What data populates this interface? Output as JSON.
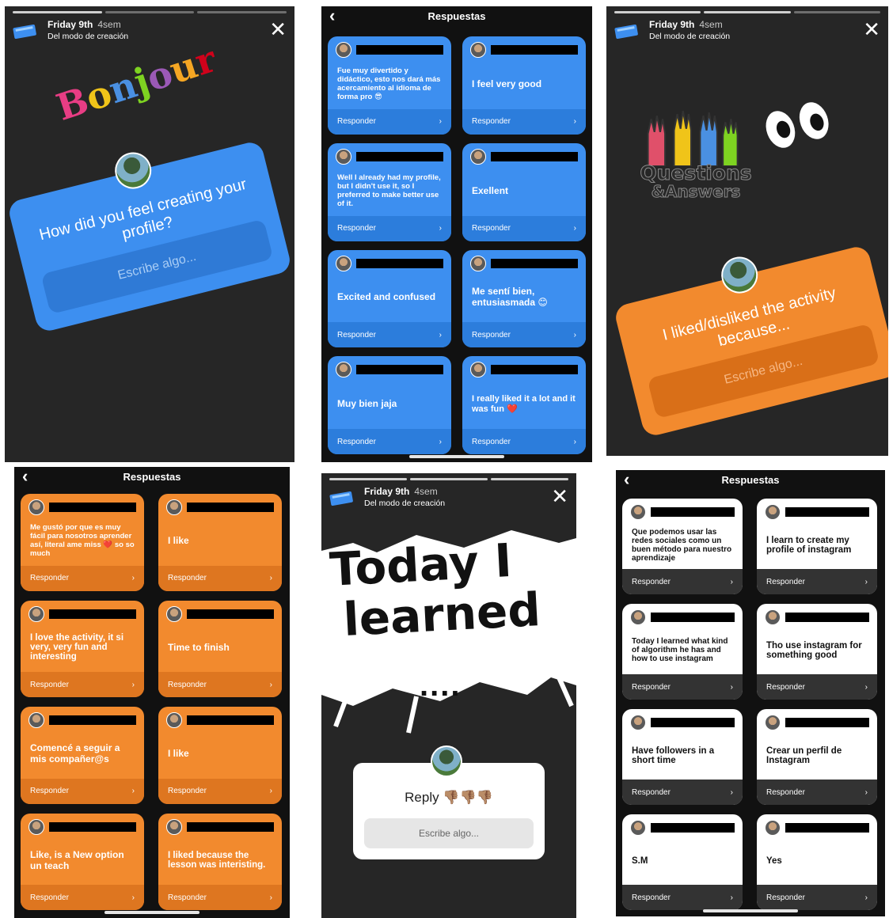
{
  "story_header": {
    "title": "Friday 9th",
    "ago": "4sem",
    "subtitle": "Del modo de creación",
    "close_glyph": "✕",
    "icon": "notebook-icon"
  },
  "panel1": {
    "word_letters": [
      "B",
      "o",
      "n",
      "j",
      "o",
      "u",
      "r"
    ],
    "word_colors": [
      "#e83d84",
      "#f0c419",
      "#4a90e2",
      "#7ed321",
      "#9b59b6",
      "#f5a623",
      "#d0021b"
    ],
    "question": "How did you feel creating your profile?",
    "placeholder": "Escribe algo...",
    "accent": "#3d8ff0"
  },
  "replies_header": {
    "title": "Respuestas",
    "back_glyph": "‹",
    "reply_label": "Responder",
    "chevron": "›"
  },
  "panel2": {
    "accent": "#3d8ff0",
    "cards": [
      {
        "text": "Fue muy divertido y didáctico, esto nos dará más acercamiento al idioma de forma pro 😎"
      },
      {
        "text": "I feel very good"
      },
      {
        "text": "Well I already had my profile, but I didn't use it, so I preferred to make better use of it."
      },
      {
        "text": "Exellent"
      },
      {
        "text": "Excited and confused"
      },
      {
        "text": "Me sentí bien, entusiasmada 😊"
      },
      {
        "text": "Muy bien jaja"
      },
      {
        "text": "I really liked it a lot and it was fun ❤️"
      }
    ]
  },
  "panel3": {
    "logo_line1": "Questions",
    "logo_line2": "&Answers",
    "question": "I liked/disliked the activity because...",
    "placeholder": "Escribe algo...",
    "accent": "#f28a2e"
  },
  "panel4": {
    "accent": "#f28a2e",
    "cards": [
      {
        "text": "Me gustó por que es muy fácil para nosotros aprender así, literal ame miss ❤️ so so much"
      },
      {
        "text": "I like"
      },
      {
        "text": "I love the activity, it si very, very fun and interesting"
      },
      {
        "text": "Time to finish"
      },
      {
        "text": "Comencé a seguir a mis compañer@s"
      },
      {
        "text": "I like"
      },
      {
        "text": "Like, is a New option un teach"
      },
      {
        "text": "I liked because the lesson was interisting."
      }
    ]
  },
  "panel5": {
    "line1": "Today I",
    "line2": "learned",
    "dots": "....",
    "question": "Reply 👎🏽👎🏽👎🏽",
    "placeholder": "Escribe algo..."
  },
  "panel6": {
    "accent": "#ffffff",
    "cards": [
      {
        "text": "Que podemos usar las redes sociales como un buen método para nuestro aprendizaje"
      },
      {
        "text": "I learn to create my profile of instagram"
      },
      {
        "text": "Today I learned what kind of algorithm he has and how to use instagram"
      },
      {
        "text": "Tho use instagram for something good"
      },
      {
        "text": "Have followers in a short time"
      },
      {
        "text": "Crear un perfil de Instagram"
      },
      {
        "text": "S.M"
      },
      {
        "text": "Yes"
      }
    ]
  }
}
